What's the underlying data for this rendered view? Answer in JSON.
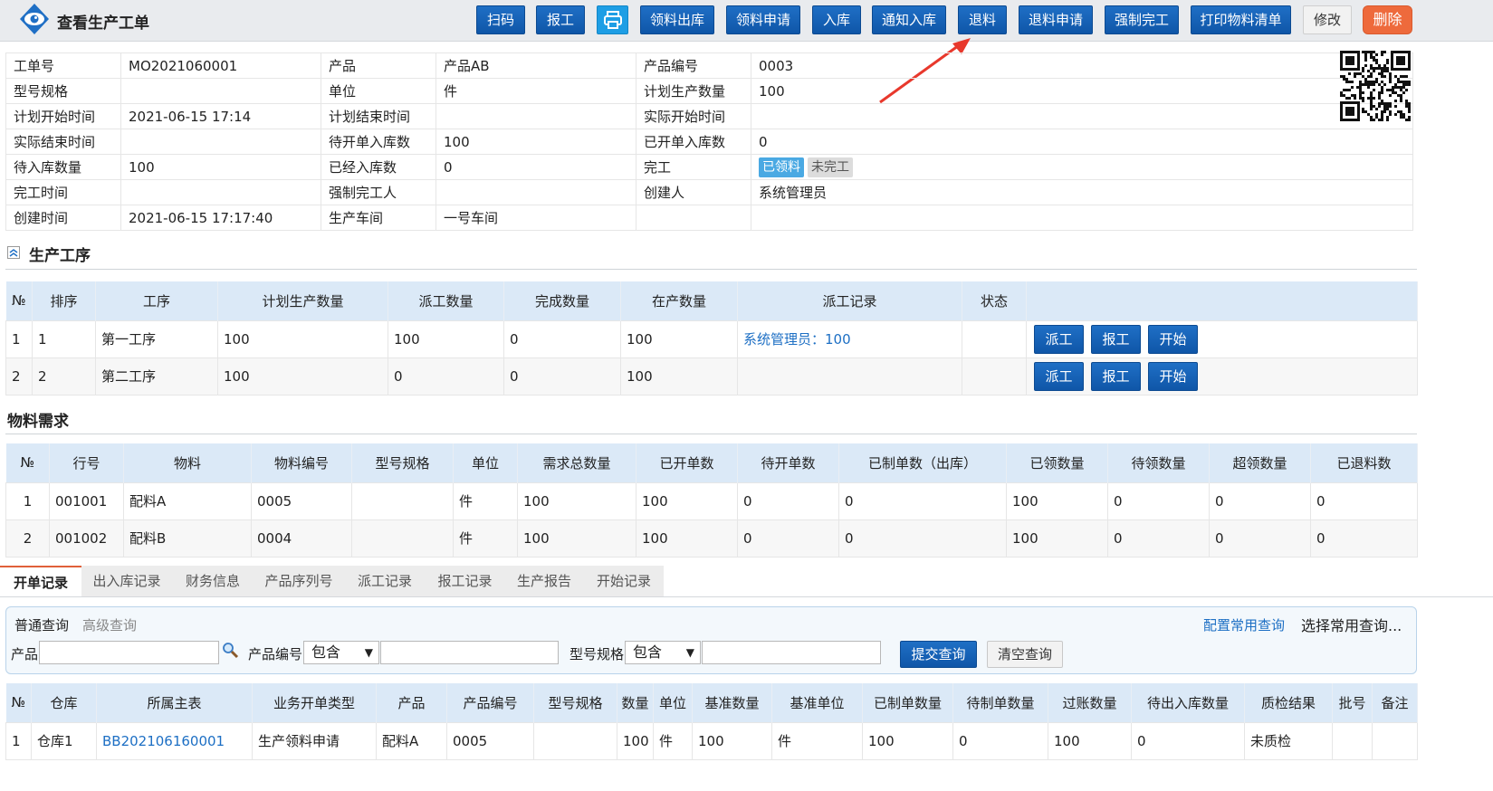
{
  "header": {
    "title": "查看生产工单",
    "buttons": {
      "scan": "扫码",
      "report": "报工",
      "issue_out": "领料出库",
      "issue_apply": "领料申请",
      "stock_in": "入库",
      "notify_in": "通知入库",
      "return": "退料",
      "return_apply": "退料申请",
      "force_complete": "强制完工",
      "print_list": "打印物料清单",
      "edit": "修改",
      "delete": "删除"
    }
  },
  "info": {
    "rows": [
      [
        "工单号",
        "MO2021060001",
        "产品",
        "产品AB",
        "产品编号",
        "0003"
      ],
      [
        "型号规格",
        "",
        "单位",
        "件",
        "计划生产数量",
        "100"
      ],
      [
        "计划开始时间",
        "2021-06-15 17:14",
        "计划结束时间",
        "",
        "实际开始时间",
        ""
      ],
      [
        "实际结束时间",
        "",
        "待开单入库数",
        "100",
        "已开单入库数",
        "0"
      ],
      [
        "待入库数量",
        "100",
        "已经入库数",
        "0",
        "完工",
        ""
      ],
      [
        "完工时间",
        "",
        "强制完工人",
        "",
        "创建人",
        "系统管理员"
      ],
      [
        "创建时间",
        "2021-06-15 17:17:40",
        "生产车间",
        "一号车间",
        "",
        ""
      ]
    ],
    "badge_issued": "已领料",
    "badge_not_done": "未完工"
  },
  "process": {
    "title": "生产工序",
    "headers": [
      "№",
      "排序",
      "工序",
      "计划生产数量",
      "派工数量",
      "完成数量",
      "在产数量",
      "派工记录",
      "状态",
      ""
    ],
    "rows": [
      [
        "1",
        "1",
        "第一工序",
        "100",
        "100",
        "0",
        "100",
        "系统管理员：100",
        ""
      ],
      [
        "2",
        "2",
        "第二工序",
        "100",
        "0",
        "0",
        "100",
        "",
        ""
      ]
    ],
    "btn_dispatch": "派工",
    "btn_report": "报工",
    "btn_start": "开始"
  },
  "material": {
    "title": "物料需求",
    "headers": [
      "№",
      "行号",
      "物料",
      "物料编号",
      "型号规格",
      "单位",
      "需求总数量",
      "已开单数",
      "待开单数",
      "已制单数（出库）",
      "已领数量",
      "待领数量",
      "超领数量",
      "已退料数"
    ],
    "rows": [
      [
        "1",
        "001001",
        "配料A",
        "0005",
        "",
        "件",
        "100",
        "100",
        "0",
        "0",
        "100",
        "0",
        "0",
        "0"
      ],
      [
        "2",
        "001002",
        "配料B",
        "0004",
        "",
        "件",
        "100",
        "100",
        "0",
        "0",
        "100",
        "0",
        "0",
        "0"
      ]
    ]
  },
  "tabs": [
    "开单记录",
    "出入库记录",
    "财务信息",
    "产品序列号",
    "派工记录",
    "报工记录",
    "生产报告",
    "开始记录"
  ],
  "query": {
    "normal": "普通查询",
    "advanced": "高级查询",
    "config": "配置常用查询",
    "common_select": "选择常用查询...",
    "product_label": "产品",
    "code_label": "产品编号",
    "spec_label": "型号规格",
    "contains": "包含",
    "submit": "提交查询",
    "clear": "清空查询"
  },
  "records": {
    "headers": [
      "№",
      "仓库",
      "所属主表",
      "业务开单类型",
      "产品",
      "产品编号",
      "型号规格",
      "数量",
      "单位",
      "基准数量",
      "基准单位",
      "已制单数量",
      "待制单数量",
      "过账数量",
      "待出入库数量",
      "质检结果",
      "批号",
      "备注"
    ],
    "rows": [
      [
        "1",
        "仓库1",
        "BB202106160001",
        "生产领料申请",
        "配料A",
        "0005",
        "",
        "100",
        "件",
        "100",
        "件",
        "100",
        "0",
        "100",
        "0",
        "未质检",
        "",
        ""
      ]
    ]
  }
}
